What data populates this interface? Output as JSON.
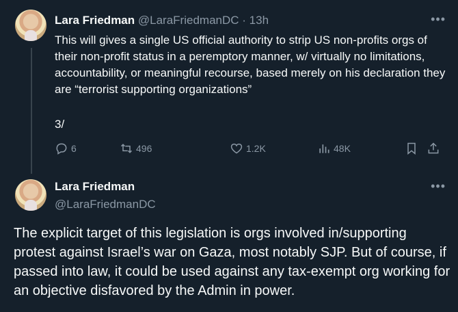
{
  "tweet1": {
    "name": "Lara Friedman",
    "handle": "@LaraFriedmanDC",
    "separator": "·",
    "time": "13h",
    "text": "This will gives a single US official authority to strip US non-profits orgs of their non-profit status in a peremptory manner, w/ virtually no limitations, accountability, or meaningful recourse, based merely on his declaration they are “terrorist supporting organizations”",
    "thread_number": "3/",
    "stats": {
      "replies": "6",
      "retweets": "496",
      "likes": "1.2K",
      "views": "48K"
    },
    "icons": {
      "reply": "reply-icon",
      "retweet": "retweet-icon",
      "like": "heart-icon",
      "views": "views-icon",
      "bookmark": "bookmark-icon",
      "share": "share-icon",
      "more": "more-icon"
    }
  },
  "tweet2": {
    "name": "Lara Friedman",
    "handle": "@LaraFriedmanDC",
    "text": "The explicit target of this legislation is orgs involved in/supporting protest against Israel’s war on Gaza, most notably SJP. But of course, if passed into law, it could be used against any tax-exempt org working for an objective disfavored by the Admin in power."
  },
  "more_label": "•••",
  "colors": {
    "background": "#15202b",
    "text": "#f7f9f9",
    "muted": "#8b98a5",
    "thread_line": "#38444d"
  }
}
